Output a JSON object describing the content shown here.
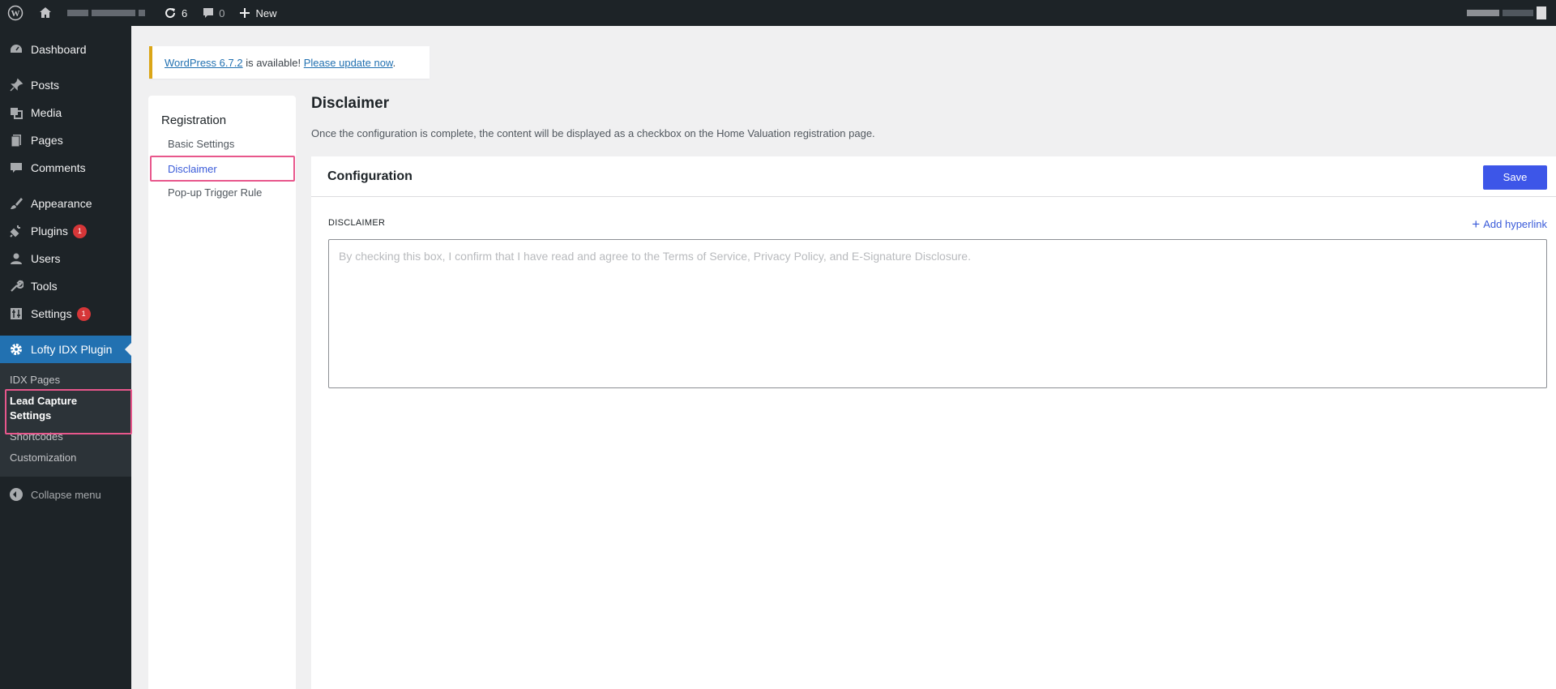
{
  "adminbar": {
    "updates_count": "6",
    "comments_count": "0",
    "new_label": "New"
  },
  "menu": {
    "items": [
      {
        "label": "Dashboard",
        "icon": "dashboard-icon"
      },
      {
        "label": "Posts",
        "icon": "pin-icon"
      },
      {
        "label": "Media",
        "icon": "media-icon"
      },
      {
        "label": "Pages",
        "icon": "pages-icon"
      },
      {
        "label": "Comments",
        "icon": "comment-icon"
      },
      {
        "label": "Appearance",
        "icon": "brush-icon"
      },
      {
        "label": "Plugins",
        "icon": "plug-icon",
        "badge": "1"
      },
      {
        "label": "Users",
        "icon": "user-icon"
      },
      {
        "label": "Tools",
        "icon": "wrench-icon"
      },
      {
        "label": "Settings",
        "icon": "settings-icon",
        "badge": "1"
      },
      {
        "label": "Lofty IDX Plugin",
        "icon": "gear-icon"
      }
    ],
    "submenu": [
      "IDX Pages",
      "Lead Capture Settings",
      "Shortcodes",
      "Customization"
    ],
    "collapse_label": "Collapse menu"
  },
  "notice": {
    "link1": "WordPress 6.7.2",
    "middle": " is available! ",
    "link2": "Please update now",
    "end": "."
  },
  "subnav": {
    "title": "Registration",
    "links": [
      "Basic Settings",
      "Disclaimer",
      "Pop-up Trigger Rule"
    ],
    "active": "Disclaimer"
  },
  "main": {
    "title": "Disclaimer",
    "description": "Once the configuration is complete, the content will be displayed as a checkbox on the Home Valuation registration page.",
    "card_title": "Configuration",
    "save_label": "Save",
    "field_label": "DISCLAIMER",
    "add_hyperlink": "Add hyperlink",
    "placeholder": "By checking this box, I confirm that I have read and agree to the Terms of Service, Privacy Policy, and E-Signature Disclosure."
  },
  "colors": {
    "admin_dark": "#1d2327",
    "wp_blue": "#2271b1",
    "primary_button": "#3d56e8",
    "highlight_pink": "#e8578c",
    "notice_warning": "#dba617"
  }
}
